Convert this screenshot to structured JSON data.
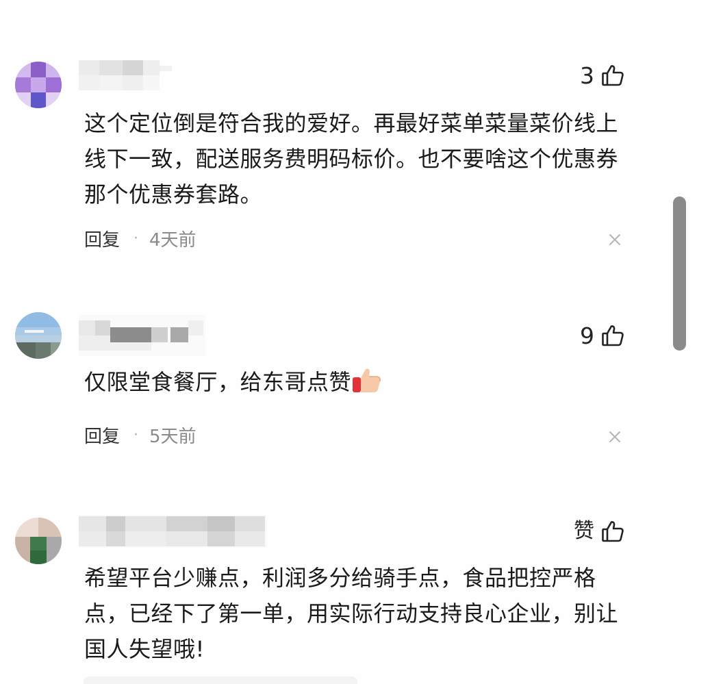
{
  "comments": [
    {
      "like_label": "3",
      "text": "这个定位倒是符合我的爱好。再最好菜单菜量菜价线上线下一致，配送服务费明码标价。也不要啥这个优惠券那个优惠券套路。",
      "reply_label": "回复",
      "separator": "·",
      "time": "4天前"
    },
    {
      "like_label": "9",
      "text": "仅限堂食餐厅，给东哥点赞",
      "emoji": "thumbs-up-emoji",
      "reply_label": "回复",
      "separator": "·",
      "time": "5天前"
    },
    {
      "like_label": "赞",
      "text": "希望平台少赚点，利润多分给骑手点，食品把控严格点，已经下了第一单，用实际行动支持良心企业，别让国人失望哦!"
    }
  ],
  "icons": {
    "like": "thumbs-up-outline-icon",
    "dismiss": "close-icon"
  },
  "colors": {
    "text": "#1a1a1a",
    "time": "#8a8a8a",
    "scrollbar": "#8a8a8a"
  }
}
